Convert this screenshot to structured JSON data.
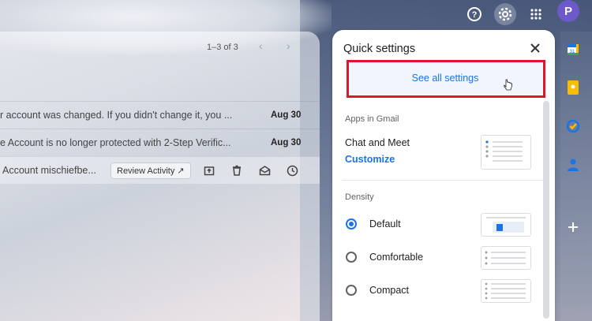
{
  "topbar": {
    "help_icon": "help-circle-icon",
    "settings_icon": "gear-icon",
    "apps_icon": "apps-grid-icon",
    "avatar_letter": "P"
  },
  "mail_list": {
    "pager": "1–3 of 3",
    "rows": [
      {
        "subject": "r account was changed. If you didn't change it, you ...",
        "date": "Aug 30"
      },
      {
        "subject": "e Account is no longer protected with 2-Step Verific...",
        "date": "Aug 30"
      },
      {
        "subject": "Account mischiefbe...",
        "action_label": "Review Activity ↗"
      }
    ]
  },
  "quick_settings": {
    "title": "Quick settings",
    "see_all": "See all settings",
    "apps_section": "Apps in Gmail",
    "chat_meet": "Chat and Meet",
    "customize": "Customize",
    "density_section": "Density",
    "density_options": [
      {
        "label": "Default",
        "selected": true
      },
      {
        "label": "Comfortable",
        "selected": false
      },
      {
        "label": "Compact",
        "selected": false
      }
    ]
  },
  "colors": {
    "accent": "#1a73e8",
    "highlight": "#e0142a"
  }
}
